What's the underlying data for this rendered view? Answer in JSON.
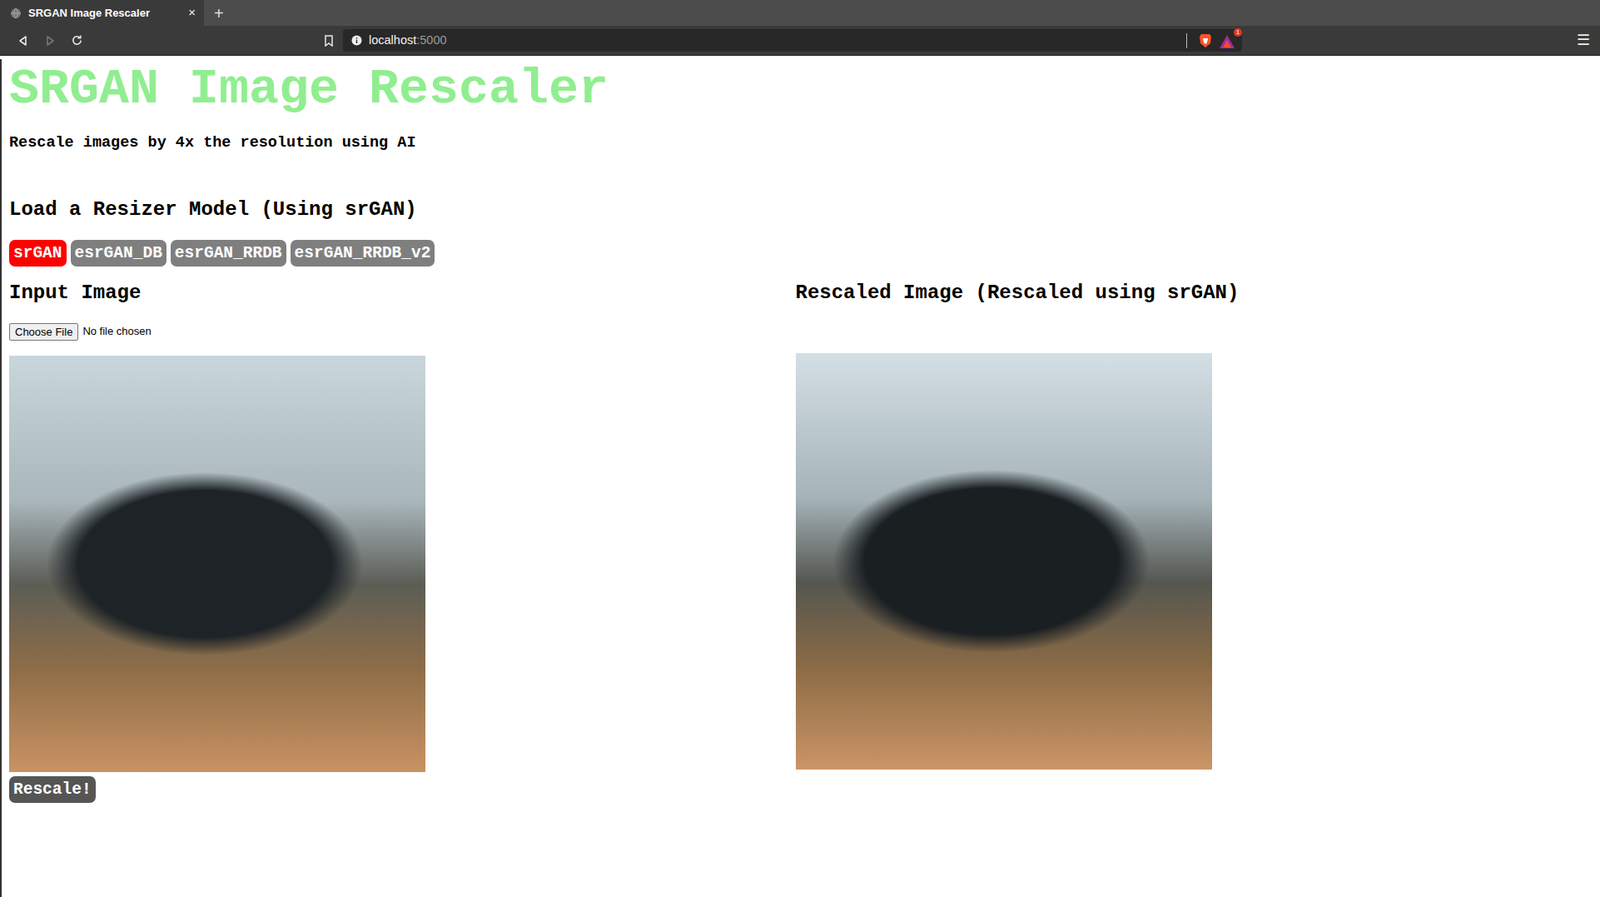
{
  "browser": {
    "tab": {
      "title": "SRGAN Image Rescaler",
      "close": "×"
    },
    "new_tab": "+",
    "nav": [
      {
        "kind": "back",
        "disabled": false
      },
      {
        "kind": "forward",
        "disabled": true
      },
      {
        "kind": "reload",
        "disabled": false
      }
    ],
    "url": {
      "host": "localhost",
      "port": ":5000"
    },
    "rewards_badge": "1",
    "menu": "☰"
  },
  "page": {
    "title": "SRGAN Image Rescaler",
    "subtitle": "Rescale images by 4x the resolution using AI",
    "model_heading": "Load a Resizer Model (Using srGAN)",
    "models": [
      {
        "label": "srGAN",
        "selected": true
      },
      {
        "label": "esrGAN_DB",
        "selected": false
      },
      {
        "label": "esrGAN_RRDB",
        "selected": false
      },
      {
        "label": "esrGAN_RRDB_v2",
        "selected": false
      }
    ],
    "input_heading": "Input Image",
    "file_button": "Choose File",
    "file_status": "No file chosen",
    "rescale_button": "Rescale!",
    "output_heading": "Rescaled Image (Rescaled using srGAN)"
  }
}
